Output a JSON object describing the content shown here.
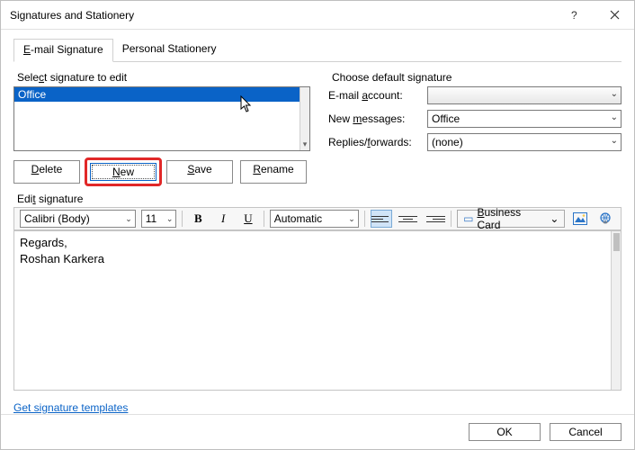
{
  "window": {
    "title": "Signatures and Stationery"
  },
  "tabs": {
    "email": "E-mail Signature",
    "stationery": "Personal Stationery"
  },
  "signatureSelect": {
    "label": "Select signature to edit",
    "items": [
      "Office"
    ],
    "buttons": {
      "delete": "Delete",
      "new": "New",
      "save": "Save",
      "rename": "Rename"
    }
  },
  "defaults": {
    "label": "Choose default signature",
    "account": {
      "label": "E-mail account:",
      "value": ""
    },
    "newMsg": {
      "label": "New messages:",
      "value": "Office"
    },
    "replies": {
      "label": "Replies/forwards:",
      "value": "(none)"
    }
  },
  "editLabel": "Edit signature",
  "toolbar": {
    "font": "Calibri (Body)",
    "size": "11",
    "color": "Automatic",
    "businessCard": "Business Card"
  },
  "editor": {
    "line1": "Regards,",
    "line2": "Roshan Karkera"
  },
  "templatesLink": "Get signature templates",
  "footer": {
    "ok": "OK",
    "cancel": "Cancel"
  }
}
